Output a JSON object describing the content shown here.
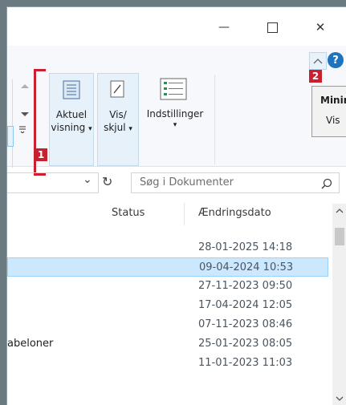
{
  "window": {
    "minimize_glyph": "—",
    "maximize_glyph": "☐",
    "close_glyph": "✕"
  },
  "ribbon": {
    "current_view": {
      "line1": "Aktuel",
      "line2": "visning",
      "caret": "▾"
    },
    "show_hide": {
      "line1": "Vis/",
      "line2": "skjul",
      "caret": "▾"
    },
    "options": {
      "label": "Indstillinger",
      "caret": "▾"
    },
    "callout1": "1",
    "callout2": "2",
    "tooltip": {
      "title": "Minir",
      "body": "Vis"
    },
    "help_glyph": "?"
  },
  "search": {
    "placeholder": "Søg i Dokumenter",
    "refresh_glyph": "↻",
    "chevron_glyph": "⌄",
    "search_glyph": "⚲"
  },
  "columns": {
    "status": "Status",
    "modified": "Ændringsdato"
  },
  "rows": [
    {
      "name": "",
      "date": "28-01-2025 14:18",
      "selected": false
    },
    {
      "name": "",
      "date": "09-04-2024 10:53",
      "selected": true
    },
    {
      "name": "",
      "date": "27-11-2023 09:50",
      "selected": false
    },
    {
      "name": "",
      "date": "17-04-2024 12:05",
      "selected": false
    },
    {
      "name": "",
      "date": "07-11-2023 08:46",
      "selected": false
    },
    {
      "name": "abeloner",
      "date": "25-01-2023 08:05",
      "selected": false
    },
    {
      "name": "",
      "date": "11-01-2023 11:03",
      "selected": false
    }
  ],
  "colors": {
    "accent": "#c8202f",
    "selection": "#cce8ff",
    "help": "#1e73be"
  }
}
